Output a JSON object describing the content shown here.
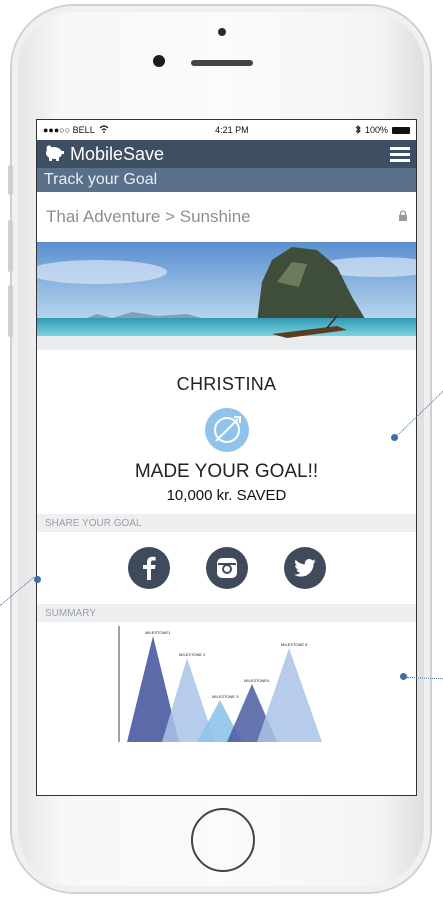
{
  "statusbar": {
    "carrier": "●●●○○ BELL",
    "time": "4:21 PM",
    "battery": "100%"
  },
  "app": {
    "name": "MobileSave",
    "subtitle": "Track your Goal"
  },
  "breadcrumb": {
    "text": "Thai Adventure > Sunshine",
    "icon": "lock-icon"
  },
  "hero": {
    "description": "beach-with-limestone-cliff-and-longtail-boat"
  },
  "goal": {
    "name": "CHRISTINA",
    "status": "MADE YOUR GOAL!!",
    "saved": "10,000 kr. SAVED"
  },
  "share": {
    "label": "SHARE YOUR GOAL",
    "networks": [
      "facebook-icon",
      "instagram-icon",
      "twitter-icon"
    ]
  },
  "summary": {
    "label": "SUMMARY",
    "milestones": [
      "MILESTONE1",
      "MILESTONE 2",
      "MILESTONE 3",
      "MILESTONE4",
      "MILESTONE 5"
    ]
  },
  "colors": {
    "appbar": "#3f4f63",
    "subbar": "#5a6f8a",
    "accent": "#3e6fa8",
    "icon_blue": "#8fc3ea"
  }
}
